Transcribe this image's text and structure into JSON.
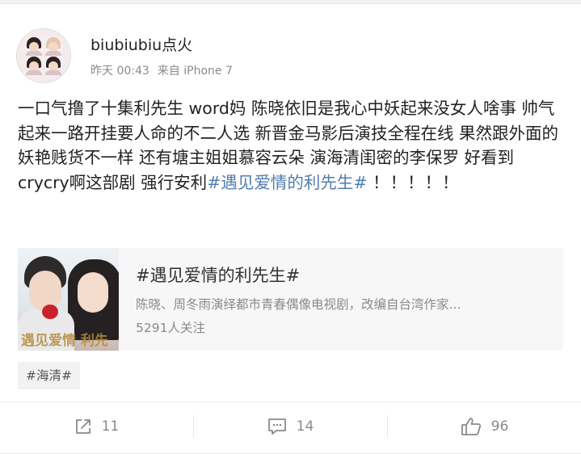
{
  "post": {
    "author": "biubiubiu点火",
    "time": "昨天 00:43",
    "source": "来自 iPhone 7",
    "text_main": "一口气撸了十集利先生 word妈 陈晓依旧是我心中妖起来没女人啥事 帅气起来一路开挂要人命的不二人选 新晋金马影后演技全程在线 果然跟外面的妖艳贱货不一样 还有塘主姐姐慕容云朵 演海清闺密的李保罗   好看到crycry啊这部剧 强行安利",
    "text_topic": "#遇见爱情的利先生#",
    "text_tail": "！！！！！"
  },
  "topic_card": {
    "poster_text": "遇见爱情 利先",
    "title": "#遇见爱情的利先生#",
    "desc": "陈晓、周冬雨演绎都市青春偶像电视剧，改编自台湾作家...",
    "follow": "5291人关注"
  },
  "tag": {
    "label": "#海清#"
  },
  "actions": {
    "repost_count": "11",
    "comment_count": "14",
    "like_count": "96"
  },
  "icons": {
    "repost": "repost-icon",
    "comment": "comment-icon",
    "like": "thumbs-up-icon"
  },
  "colors": {
    "topic_link": "#507daf",
    "meta_text": "#8a8a8a"
  }
}
